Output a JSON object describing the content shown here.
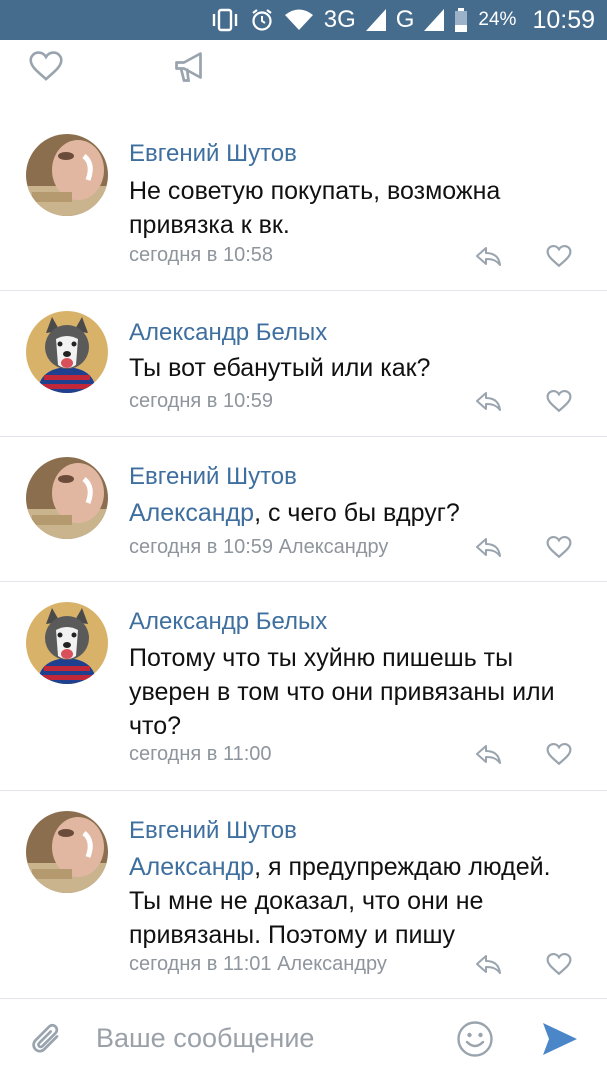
{
  "status_bar": {
    "network_3g": "3G",
    "network_g": "G",
    "battery_percent": "24%",
    "time": "10:59",
    "icons": [
      "vibrate-icon",
      "alarm-icon",
      "wifi-icon",
      "signal-icon",
      "signal-icon",
      "battery-icon"
    ]
  },
  "top_actions": {
    "icons": [
      "heart-icon",
      "megaphone-icon"
    ]
  },
  "comments": [
    {
      "author": "Евгений Шутов",
      "mention": "",
      "text": "Не советую покупать, возможна привязка к вк.",
      "time": "сегодня в 10:58",
      "reply_to": "",
      "avatar": "photo-man"
    },
    {
      "author": "Александр Белых",
      "mention": "",
      "text": "Ты вот ебанутый или как?",
      "time": "сегодня в 10:59",
      "reply_to": "",
      "avatar": "photo-husky"
    },
    {
      "author": "Евгений Шутов",
      "mention": "Александр",
      "text": ", с чего бы вдруг?",
      "time": "сегодня в 10:59",
      "reply_to": "Александру",
      "avatar": "photo-man"
    },
    {
      "author": "Александр Белых",
      "mention": "",
      "text": "Потому что ты хуйню пишешь ты уверен в том что они привязаны или что?",
      "time": "сегодня в 11:00",
      "reply_to": "",
      "avatar": "photo-husky"
    },
    {
      "author": "Евгений Шутов",
      "mention": "Александр",
      "text": ", я предупреждаю людей. Ты мне не доказал, что они не привязаны. Поэтому и пишу",
      "time": "сегодня в 11:01",
      "reply_to": "Александру",
      "avatar": "photo-man"
    }
  ],
  "composer": {
    "placeholder": "Ваше сообщение",
    "icons": [
      "attach-icon",
      "emoji-icon",
      "send-icon"
    ]
  },
  "colors": {
    "status_bar": "#456b8d",
    "author": "#3f6f9f",
    "meta": "#8e959c",
    "send": "#4a86c8",
    "icons": "#9aa4ae"
  }
}
